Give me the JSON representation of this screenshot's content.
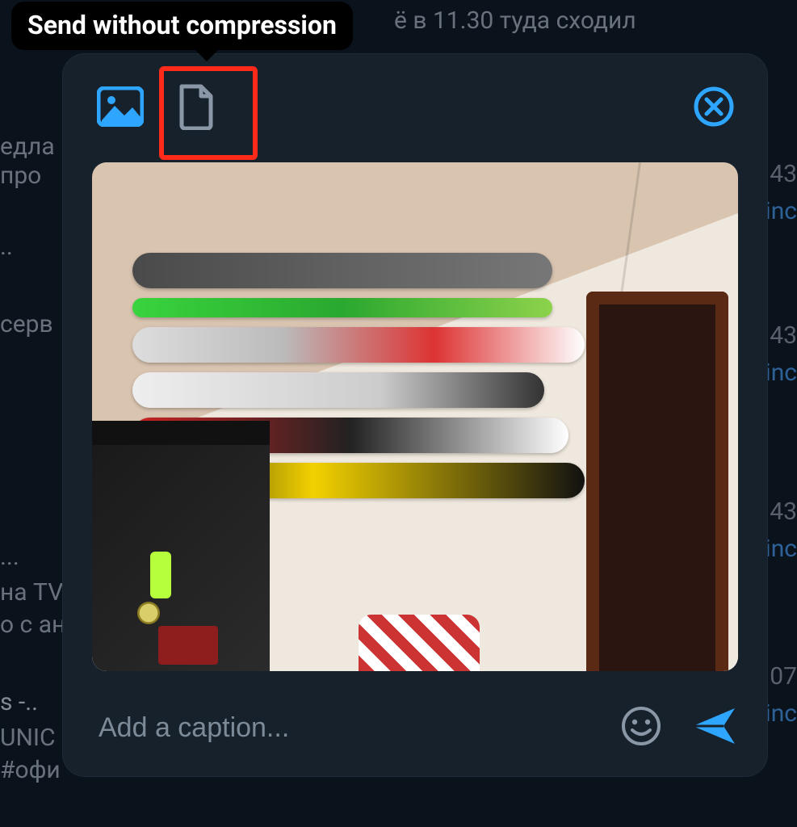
{
  "tooltip": {
    "label": "Send without compression"
  },
  "panel": {
    "modes": {
      "image": "image-mode",
      "file": "file-mode"
    },
    "close": "close"
  },
  "caption": {
    "placeholder": "Add a caption...",
    "value": ""
  },
  "background": {
    "top_message": "ё в 11.30 туда сходил",
    "sidebar": {
      "line1": "едла",
      "line2": "про",
      "line3": "..",
      "line4": "серв",
      "line5": "...",
      "line6": "на TV",
      "line7": "о с ан",
      "line8": "s -..",
      "line9": "UNIC",
      "line10": "#офи"
    },
    "right": {
      "time1": "43",
      "link1": "inc",
      "time2": "43",
      "link2": "inc",
      "time3": "43",
      "link3": "inc",
      "time4": "07",
      "link4": "inc"
    }
  },
  "colors": {
    "accent": "#2ea6ff",
    "highlight": "#ff2a1a",
    "panel": "#17212b"
  }
}
